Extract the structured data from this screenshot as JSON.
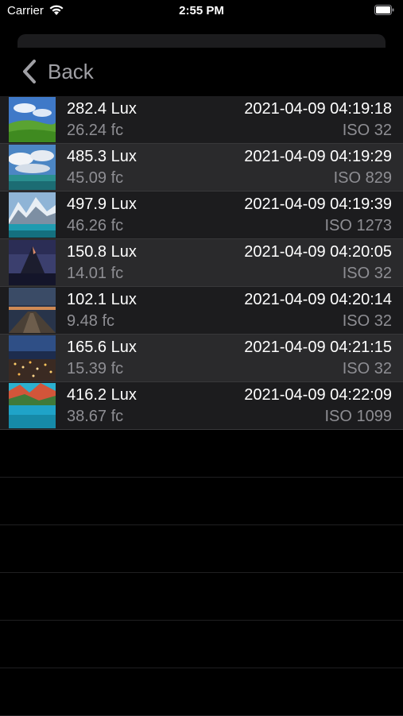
{
  "status_bar": {
    "carrier": "Carrier",
    "time": "2:55 PM"
  },
  "nav": {
    "back_label": "Back"
  },
  "readings": [
    {
      "lux": "282.4 Lux",
      "fc": "26.24 fc",
      "timestamp": "2021-04-09 04:19:18",
      "iso": "ISO 32",
      "thumb": "green-hills-photo"
    },
    {
      "lux": "485.3 Lux",
      "fc": "45.09 fc",
      "timestamp": "2021-04-09 04:19:29",
      "iso": "ISO 829",
      "thumb": "clouds-sea-photo"
    },
    {
      "lux": "497.9 Lux",
      "fc": "46.26 fc",
      "timestamp": "2021-04-09 04:19:39",
      "iso": "ISO 1273",
      "thumb": "mountain-lake-photo"
    },
    {
      "lux": "150.8 Lux",
      "fc": "14.01 fc",
      "timestamp": "2021-04-09 04:20:05",
      "iso": "ISO 32",
      "thumb": "matterhorn-dusk-photo"
    },
    {
      "lux": "102.1 Lux",
      "fc": "9.48 fc",
      "timestamp": "2021-04-09 04:20:14",
      "iso": "ISO 32",
      "thumb": "pier-night-photo"
    },
    {
      "lux": "165.6 Lux",
      "fc": "15.39 fc",
      "timestamp": "2021-04-09 04:21:15",
      "iso": "ISO 32",
      "thumb": "city-night-photo"
    },
    {
      "lux": "416.2 Lux",
      "fc": "38.67 fc",
      "timestamp": "2021-04-09 04:22:09",
      "iso": "ISO 1099",
      "thumb": "autumn-lake-photo"
    }
  ],
  "colors": {
    "row_odd": "#1c1c1e",
    "row_even": "#2a2a2c",
    "secondary_text": "#8e8e93",
    "separator": "#38383a"
  }
}
